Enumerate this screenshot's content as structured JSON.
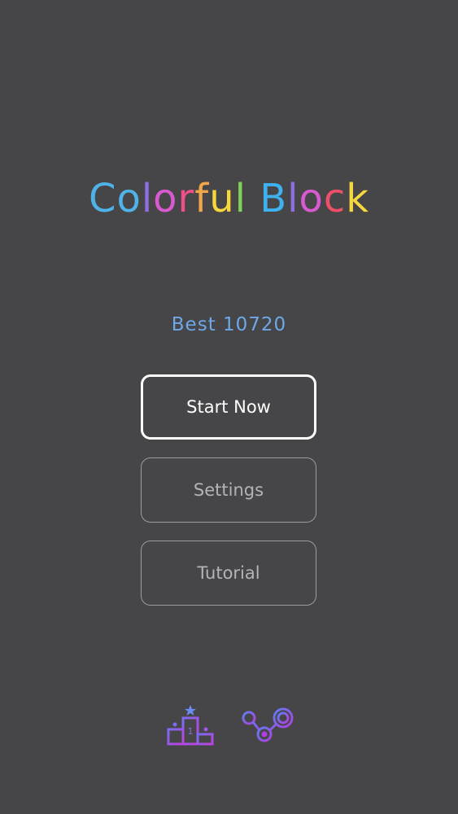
{
  "title": {
    "letters": [
      {
        "char": "C",
        "color": "#4fb3e8"
      },
      {
        "char": "o",
        "color": "#4fb3e8"
      },
      {
        "char": "l",
        "color": "#8e6fe0"
      },
      {
        "char": "o",
        "color": "#d85ad0"
      },
      {
        "char": "r",
        "color": "#f04f8a"
      },
      {
        "char": "f",
        "color": "#f0a64a"
      },
      {
        "char": "u",
        "color": "#f6d83e"
      },
      {
        "char": "l",
        "color": "#7ed35a"
      },
      {
        "char": " ",
        "color": "#ffffff"
      },
      {
        "char": "B",
        "color": "#3fb0f0"
      },
      {
        "char": "l",
        "color": "#8e6fe0"
      },
      {
        "char": "o",
        "color": "#d85ad0"
      },
      {
        "char": "c",
        "color": "#f04f6a"
      },
      {
        "char": "k",
        "color": "#f6d83e"
      }
    ]
  },
  "best": {
    "text": "Best  10720"
  },
  "menu": {
    "start_label": "Start Now",
    "settings_label": "Settings",
    "tutorial_label": "Tutorial"
  },
  "icons": {
    "leaderboard": "leaderboard-podium-icon",
    "share": "share-icon",
    "podium_rank": "1"
  },
  "colors": {
    "background": "#464547",
    "best_text": "#6ea8e8",
    "icon_gradient_start": "#7b6cf0",
    "icon_gradient_end": "#c040e0"
  }
}
